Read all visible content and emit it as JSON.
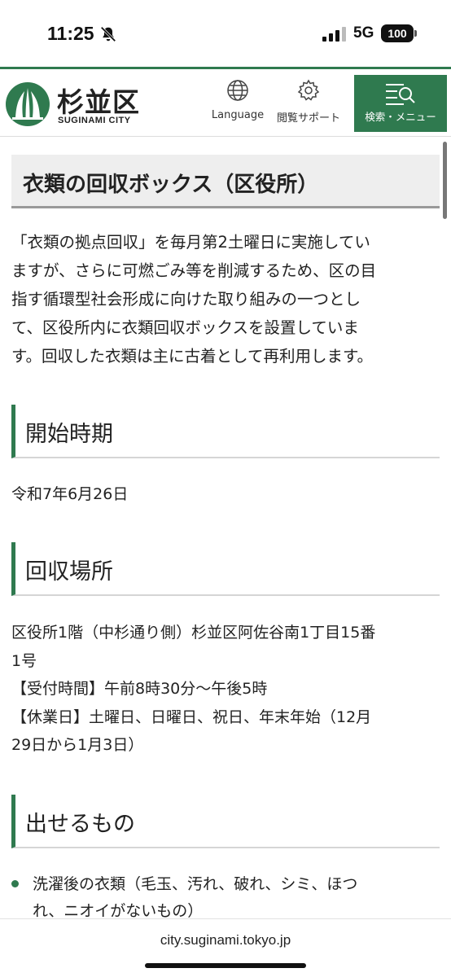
{
  "status_bar": {
    "time": "11:25",
    "network": "5G",
    "battery": "100",
    "icons": [
      "bell-slash-icon",
      "signal-icon",
      "battery-icon"
    ]
  },
  "header": {
    "logo_kanji": "杉並区",
    "logo_en": "SUGINAMI CITY",
    "language_label": "Language",
    "support_label": "閲覧サポート",
    "menu_label": "検索・メニュー",
    "accent_color": "#2f7a4f"
  },
  "page": {
    "title": "衣類の回収ボックス（区役所）",
    "intro_lines": [
      "「衣類の拠点回収」を毎月第2土曜日に実施してい",
      "ますが、さらに可燃ごみ等を削減するため、区の目",
      "指す循環型社会形成に向けた取り組みの一つとし",
      "て、区役所内に衣類回収ボックスを設置していま",
      "す。回収した衣類は主に古着として再利用します。"
    ],
    "sections": [
      {
        "heading": "開始時期",
        "lines": [
          "令和7年6月26日"
        ]
      },
      {
        "heading": "回収場所",
        "lines": [
          "区役所1階（中杉通り側）杉並区阿佐谷南1丁目15番",
          "1号",
          "【受付時間】午前8時30分～午後5時",
          "【休業日】土曜日、日曜日、祝日、年末年始（12月",
          "29日から1月3日）"
        ]
      },
      {
        "heading": "出せるもの",
        "bullets": [
          [
            "洗濯後の衣類（毛玉、汚れ、破れ、シミ、ほつ",
            "れ、ニオイがないもの）"
          ]
        ]
      }
    ]
  },
  "browser": {
    "url": "city.suginami.tokyo.jp"
  }
}
